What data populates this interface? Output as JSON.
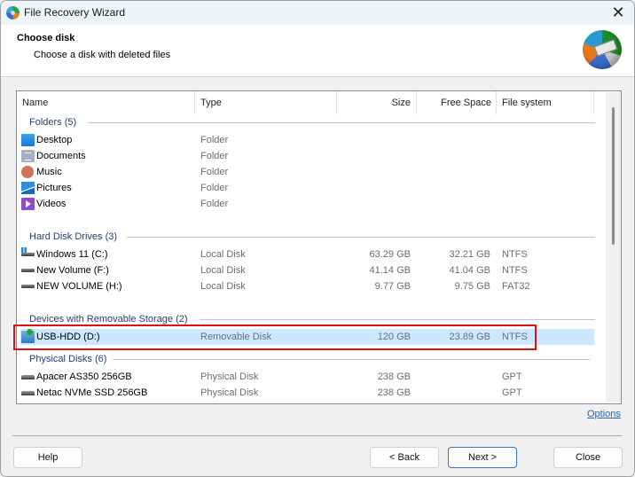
{
  "window": {
    "title": "File Recovery Wizard"
  },
  "header": {
    "title": "Choose disk",
    "subtitle": "Choose a disk with deleted files"
  },
  "columns": {
    "name": "Name",
    "type": "Type",
    "size": "Size",
    "free": "Free Space",
    "fs": "File system"
  },
  "groups": [
    {
      "label": "Folders (5)"
    },
    {
      "label": "Hard Disk Drives (3)"
    },
    {
      "label": "Devices with Removable Storage (2)"
    },
    {
      "label": "Physical Disks (6)"
    }
  ],
  "rows": [
    {
      "icon": "desktop-icon",
      "name": "Desktop",
      "type": "Folder",
      "size": "",
      "free": "",
      "fs": ""
    },
    {
      "icon": "documents-icon",
      "name": "Documents",
      "type": "Folder",
      "size": "",
      "free": "",
      "fs": ""
    },
    {
      "icon": "music-icon",
      "name": "Music",
      "type": "Folder",
      "size": "",
      "free": "",
      "fs": ""
    },
    {
      "icon": "pictures-icon",
      "name": "Pictures",
      "type": "Folder",
      "size": "",
      "free": "",
      "fs": ""
    },
    {
      "icon": "videos-icon",
      "name": "Videos",
      "type": "Folder",
      "size": "",
      "free": "",
      "fs": ""
    },
    {
      "icon": "windows-drive-icon",
      "name": "Windows 11 (C:)",
      "type": "Local Disk",
      "size": "63.29 GB",
      "free": "32.21 GB",
      "fs": "NTFS"
    },
    {
      "icon": "drive-icon",
      "name": "New Volume (F:)",
      "type": "Local Disk",
      "size": "41.14 GB",
      "free": "41.04 GB",
      "fs": "NTFS"
    },
    {
      "icon": "drive-icon",
      "name": "NEW VOLUME (H:)",
      "type": "Local Disk",
      "size": "9.77 GB",
      "free": "9.75 GB",
      "fs": "FAT32"
    },
    {
      "icon": "usb-drive-icon",
      "name": "USB-HDD (D:)",
      "type": "Removable Disk",
      "size": "120 GB",
      "free": "23.89 GB",
      "fs": "NTFS",
      "selected": true
    },
    {
      "icon": "physical-disk-icon",
      "name": "Apacer AS350 256GB",
      "type": "Physical Disk",
      "size": "238 GB",
      "free": "",
      "fs": "GPT"
    },
    {
      "icon": "physical-disk-icon",
      "name": "Netac NVMe SSD 256GB",
      "type": "Physical Disk",
      "size": "238 GB",
      "free": "",
      "fs": "GPT"
    }
  ],
  "links": {
    "options": "Options"
  },
  "buttons": {
    "help": "Help",
    "back": "< Back",
    "next": "Next >",
    "close": "Close"
  },
  "icons": {
    "close": "close-icon",
    "app": "app-icon",
    "logo": "recovery-logo-icon"
  },
  "colors": {
    "accent": "#3575c9",
    "selection": "#cce8ff",
    "group_text": "#1f3f7a",
    "highlight_box": "#e01010",
    "link": "#1a66c8"
  }
}
